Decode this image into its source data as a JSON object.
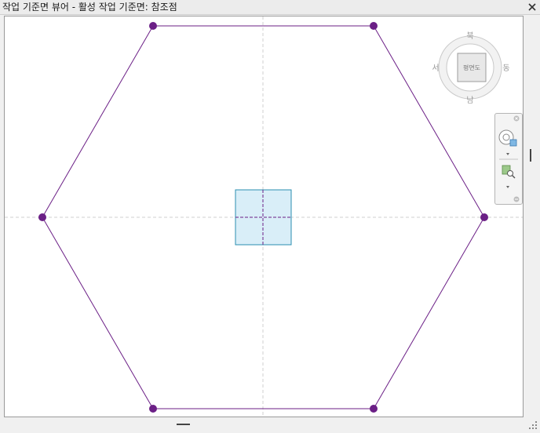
{
  "window": {
    "title": "작업 기준면 뷰어 - 활성 작업 기준면: 참조점"
  },
  "viewcube": {
    "north": "북",
    "south": "남",
    "east": "동",
    "west": "서",
    "face": "평면도"
  },
  "colors": {
    "outline": "#6b1f86",
    "point": "#6b1f86",
    "workplane_fill": "#d9eef8",
    "workplane_border": "#2b8fb0",
    "axis": "#c8c8c8"
  },
  "icons": {
    "close": "close-icon",
    "orbit": "steering-wheel-icon",
    "zoom": "zoom-region-icon",
    "grip": "resize-grip-icon"
  }
}
